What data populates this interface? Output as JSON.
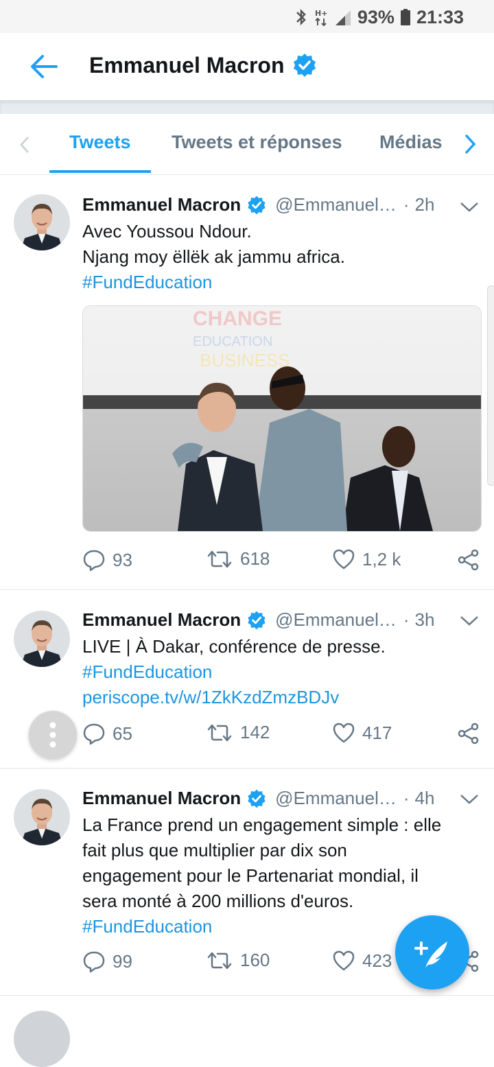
{
  "status": {
    "battery": "93%",
    "time": "21:33"
  },
  "header": {
    "title": "Emmanuel Macron"
  },
  "tabs": [
    {
      "label": "Tweets"
    },
    {
      "label": "Tweets et réponses"
    },
    {
      "label": "Médias"
    }
  ],
  "tweets": [
    {
      "name": "Emmanuel Macron",
      "handle": "@Emmanuel…",
      "dot": "·",
      "time": "2h",
      "lines": [
        "Avec Youssou Ndour.",
        "Njang moy ëllëk ak jammu africa."
      ],
      "hashtag": "#FundEducation",
      "media_text": [
        "CHANGE",
        "EDUCATION",
        "BUSINESS"
      ],
      "replies": "93",
      "retweets": "618",
      "likes": "1,2 k"
    },
    {
      "name": "Emmanuel Macron",
      "handle": "@Emmanuel…",
      "dot": "·",
      "time": "3h",
      "lines": [
        "LIVE | À Dakar, conférence de presse."
      ],
      "hashtag": "#FundEducation",
      "link": "periscope.tv/w/1ZkKzdZmzBDJv",
      "replies": "65",
      "retweets": "142",
      "likes": "417"
    },
    {
      "name": "Emmanuel Macron",
      "handle": "@Emmanuel…",
      "dot": "·",
      "time": "4h",
      "lines": [
        "La France prend un engagement simple : elle",
        "fait plus que multiplier par dix son",
        "engagement pour le Partenariat mondial, il",
        "sera monté à 200 millions d'euros."
      ],
      "hashtag": "#FundEducation",
      "replies": "99",
      "retweets": "160",
      "likes": "423"
    }
  ],
  "colors": {
    "accent": "#1da1f2",
    "link": "#1b95e0",
    "muted": "#657786"
  },
  "icons": [
    "bluetooth-icon",
    "data-icon",
    "signal-icon",
    "battery-icon",
    "back-arrow-icon",
    "verified-badge-icon",
    "chevron-left-icon",
    "chevron-right-icon",
    "caret-down-icon",
    "reply-icon",
    "retweet-icon",
    "like-icon",
    "share-icon",
    "compose-icon",
    "more-dots-icon"
  ]
}
